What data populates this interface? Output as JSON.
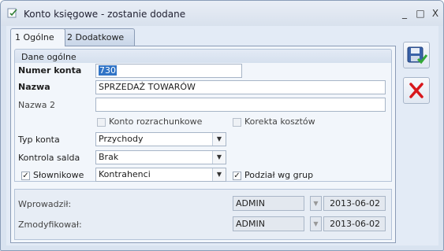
{
  "window": {
    "title": "Konto księgowe - zostanie dodane",
    "minimize": "_",
    "maximize": "□",
    "close": "X"
  },
  "tabs": [
    {
      "label": "1 Ogólne",
      "active": true
    },
    {
      "label": "2 Dodatkowe",
      "active": false
    }
  ],
  "section": {
    "title": "Dane ogólne"
  },
  "form": {
    "numer_konta": {
      "label": "Numer konta",
      "value": "730"
    },
    "nazwa": {
      "label": "Nazwa",
      "value": "SPRZEDAŻ TOWARÓW"
    },
    "nazwa2": {
      "label": "Nazwa 2",
      "value": ""
    },
    "konto_rozrachunkowe": {
      "label": "Konto rozrachunkowe",
      "checked": false
    },
    "korekta_kosztow": {
      "label": "Korekta kosztów",
      "checked": false
    },
    "typ_konta": {
      "label": "Typ konta",
      "value": "Przychody"
    },
    "kontrola_salda": {
      "label": "Kontrola salda",
      "value": "Brak"
    },
    "slownikowe": {
      "label": "Słownikowe",
      "checked": true,
      "value": "Kontrahenci"
    },
    "podzial_wg_grup": {
      "label": "Podział wg grup",
      "checked": true
    }
  },
  "audit": {
    "wprowadzil": {
      "label": "Wprowadził:",
      "user": "ADMIN",
      "date": "2013-06-02"
    },
    "zmodyfikowal": {
      "label": "Zmodyfikował:",
      "user": "ADMIN",
      "date": "2013-06-02"
    }
  },
  "icons": {
    "save": "save-floppy-check-icon",
    "cancel": "red-x-icon",
    "dropdown": "▼",
    "check": "✓"
  },
  "colors": {
    "accent": "#3174c6",
    "cancel_red": "#d8171c",
    "save_green": "#33a836"
  }
}
